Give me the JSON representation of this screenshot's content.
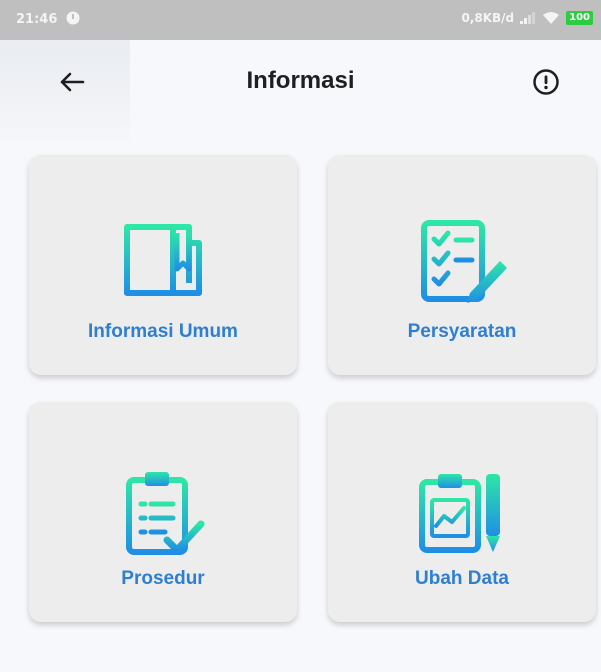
{
  "status_bar": {
    "time": "21:46",
    "network_speed": "0,8KB/d",
    "battery": "100"
  },
  "header": {
    "title": "Informasi",
    "back_icon": "arrow-left-icon",
    "info_icon": "exclamation-circle-icon"
  },
  "menu": [
    {
      "label": "Informasi Umum",
      "icon": "book-icon"
    },
    {
      "label": "Persyaratan",
      "icon": "checklist-pencil-icon"
    },
    {
      "label": "Prosedur",
      "icon": "clipboard-check-icon"
    },
    {
      "label": "Ubah Data",
      "icon": "clipboard-chart-pencil-icon"
    }
  ],
  "colors": {
    "accent_text": "#2f7fd1",
    "icon_gradient_top": "#2ee6a6",
    "icon_gradient_bottom": "#1f8fe6",
    "card_background": "#ededee",
    "status_bar": "#bfbfbf"
  }
}
